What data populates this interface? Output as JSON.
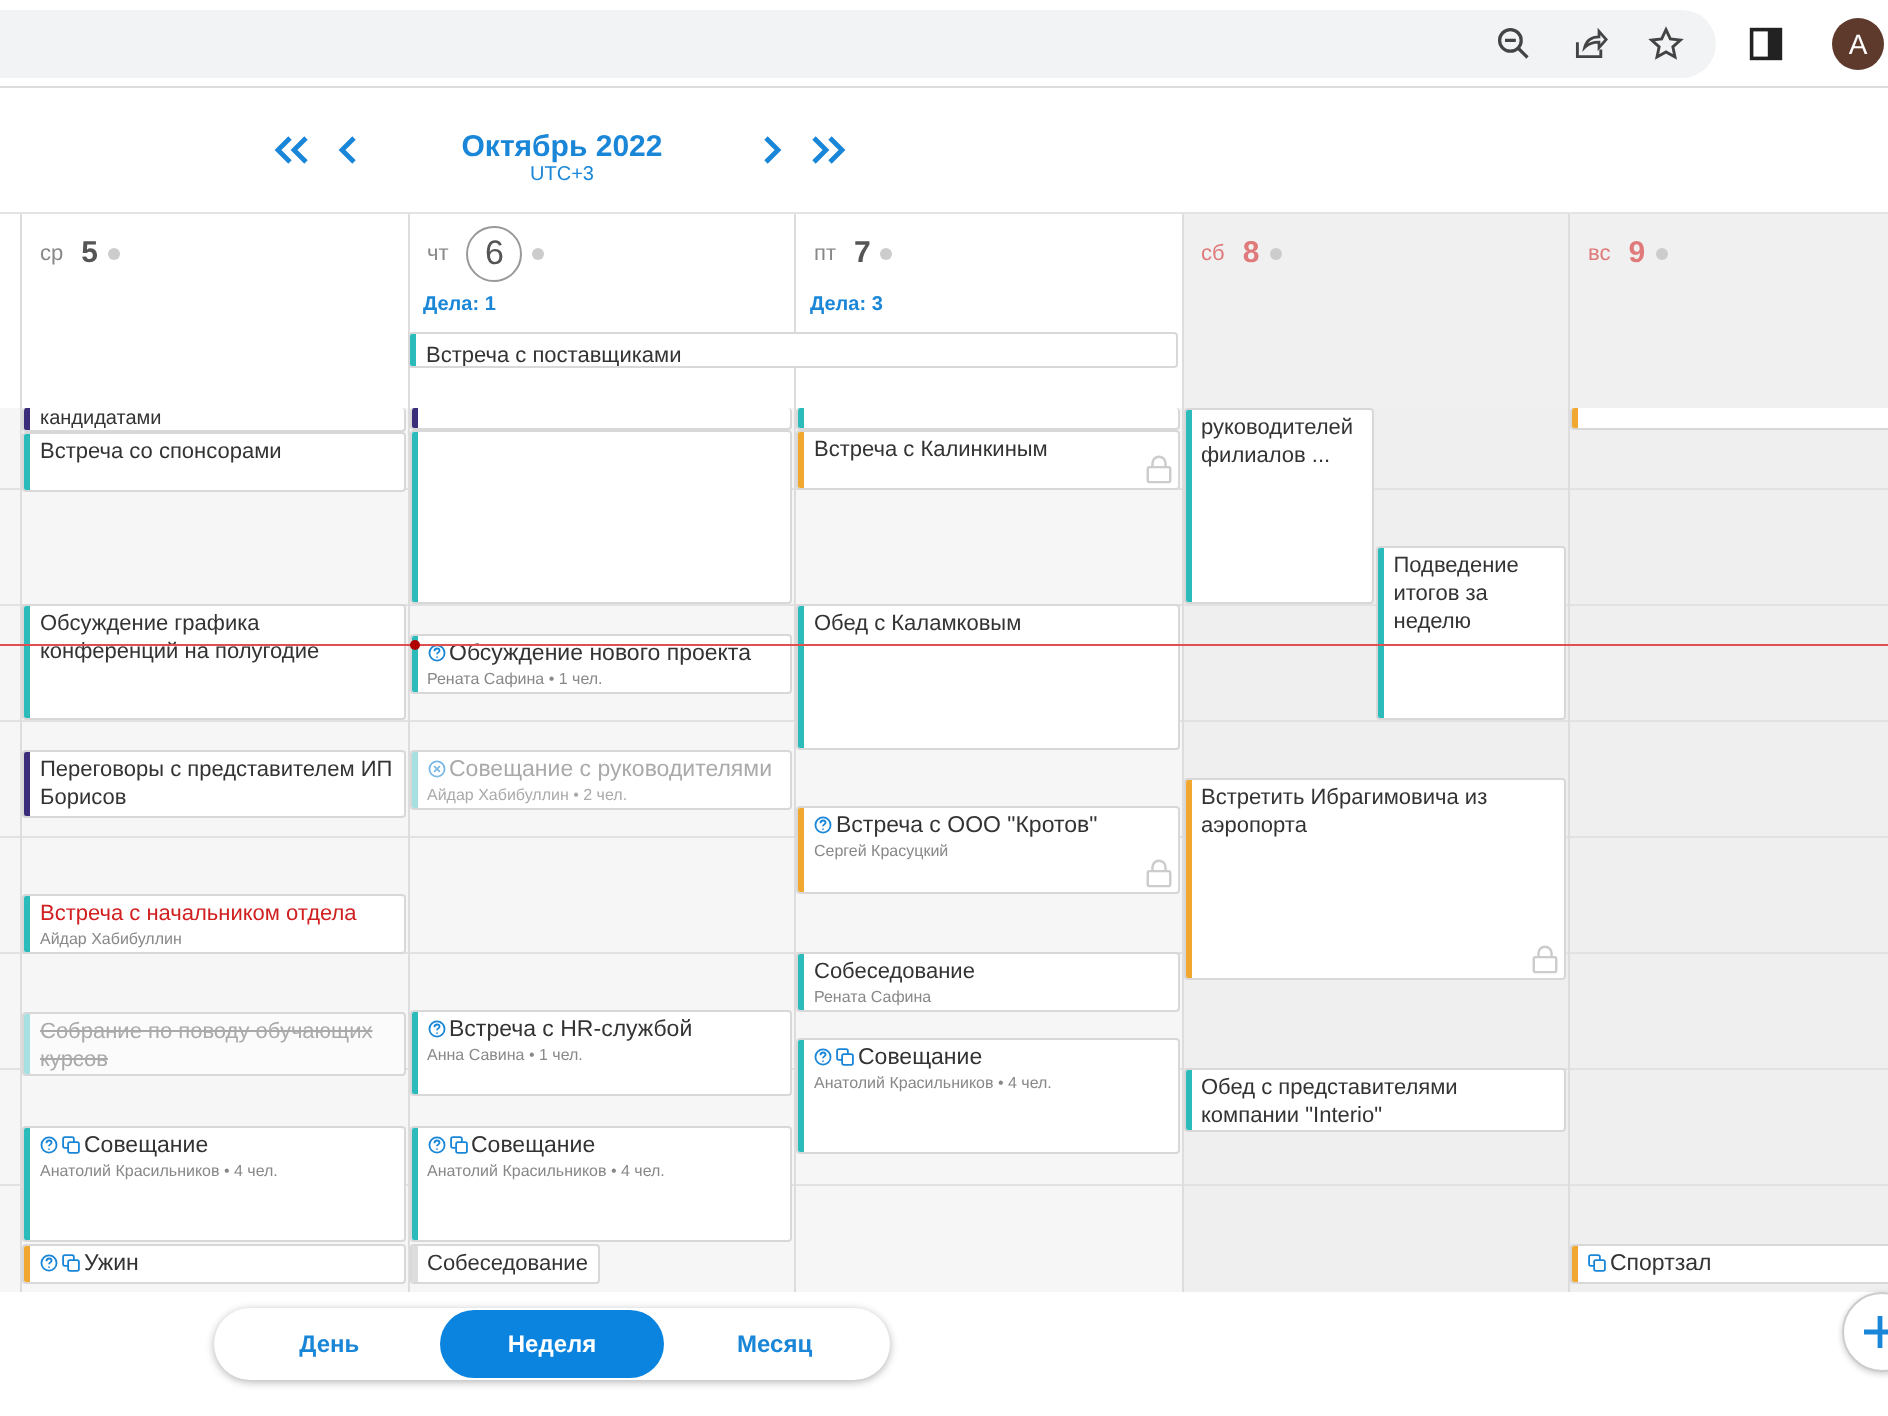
{
  "browser": {
    "avatar": "A"
  },
  "nav": {
    "title": "Октябрь 2022",
    "timezone": "UTC+3"
  },
  "all_day": [
    {
      "title": "Встреча с поставщиками",
      "color": "#2bbbbb"
    }
  ],
  "days": [
    {
      "name": "ср",
      "number": "5",
      "weekend": false,
      "today": false,
      "events": [
        {
          "kind": "plain",
          "title": "кандидатами",
          "color": "#3b2d7a"
        },
        {
          "kind": "plain",
          "title": "Встреча со спонсорами",
          "color": "#2bbbbb"
        },
        {
          "kind": "plain",
          "title": "Обсуждение графика конференций на полугодие",
          "color": "#2bbbbb"
        },
        {
          "kind": "plain",
          "title": "Переговоры с представителем ИП Борисов",
          "color": "#3b2d7a"
        },
        {
          "kind": "plain",
          "title": "Встреча с начальником отдела",
          "subtitle": "Айдар Хабибуллин",
          "color": "#2bbbbb",
          "highlighted": true
        },
        {
          "kind": "plain",
          "title": "Собрание по поводу обучающих курсов",
          "color": "#a6e0e0",
          "cancelled": true
        },
        {
          "kind": "unanswered",
          "title": "Совещание",
          "subtitle": "Анатолий Красильников • 4 чел.",
          "color": "#2bbbbb",
          "recurring": true
        },
        {
          "kind": "unanswered",
          "title": "Ужин",
          "color": "#f0a830",
          "recurring": true
        }
      ]
    },
    {
      "name": "чт",
      "number": "6",
      "weekend": false,
      "today": true,
      "tasks": "Дела: 1",
      "events": [
        {
          "kind": "plain",
          "color": "#3b2d7a"
        },
        {
          "kind": "plain",
          "color": "#2bbbbb"
        },
        {
          "kind": "unanswered",
          "title": "Обсуждение нового проекта",
          "subtitle": "Рената Сафина • 1 чел.",
          "color": "#2bbbbb"
        },
        {
          "kind": "declined",
          "title": "Совещание с руководителями",
          "subtitle": "Айдар Хабибуллин • 2 чел.",
          "color": "#a6e0e0"
        },
        {
          "kind": "unanswered",
          "title": "Встреча с HR-службой",
          "subtitle": "Анна Савина • 1 чел.",
          "color": "#2bbbbb"
        },
        {
          "kind": "unanswered",
          "title": "Совещание",
          "subtitle": "Анатолий Красильников • 4 чел.",
          "color": "#2bbbbb",
          "recurring": true
        },
        {
          "kind": "plain",
          "title": "Собеседование",
          "color": "#dddddd"
        }
      ]
    },
    {
      "name": "пт",
      "number": "7",
      "weekend": false,
      "today": false,
      "tasks": "Дела: 3",
      "events": [
        {
          "kind": "plain",
          "color": "#2bbbbb"
        },
        {
          "kind": "plain",
          "title": "Встреча с Калинкиным",
          "color": "#f0a830",
          "locked": true
        },
        {
          "kind": "plain",
          "title": "Обед с Каламковым",
          "color": "#2bbbbb"
        },
        {
          "kind": "unanswered",
          "title": "Встреча с ООО \"Кротов\"",
          "subtitle": "Сергей Красуцкий",
          "color": "#f0a830",
          "locked": true
        },
        {
          "kind": "plain",
          "title": "Собеседование",
          "subtitle": "Рената Сафина",
          "color": "#2bbbbb"
        },
        {
          "kind": "unanswered",
          "title": "Совещание",
          "subtitle": "Анатолий Красильников • 4 чел.",
          "color": "#2bbbbb",
          "recurring": true
        }
      ]
    },
    {
      "name": "сб",
      "number": "8",
      "weekend": true,
      "today": false,
      "events": [
        {
          "kind": "plain",
          "title": "руководителей филиалов ...",
          "color": "#2bbbbb"
        },
        {
          "kind": "plain",
          "title": "Подведение итогов за неделю",
          "color": "#2bbbbb"
        },
        {
          "kind": "plain",
          "title": "Встретить Ибрагимовича из аэропорта",
          "color": "#f0a830",
          "locked": true
        },
        {
          "kind": "plain",
          "title": "Обед с представителями компании \"Interio\"",
          "color": "#2bbbbb"
        }
      ]
    },
    {
      "name": "вс",
      "number": "9",
      "weekend": true,
      "today": false,
      "events": [
        {
          "kind": "plain",
          "color": "#f0a830"
        },
        {
          "kind": "plain",
          "title": "Спортзал",
          "color": "#f0a830",
          "recurring": true
        }
      ]
    }
  ],
  "views": [
    {
      "label": "День",
      "selected": false
    },
    {
      "label": "Неделя",
      "selected": true
    },
    {
      "label": "Месяц",
      "selected": false
    }
  ]
}
